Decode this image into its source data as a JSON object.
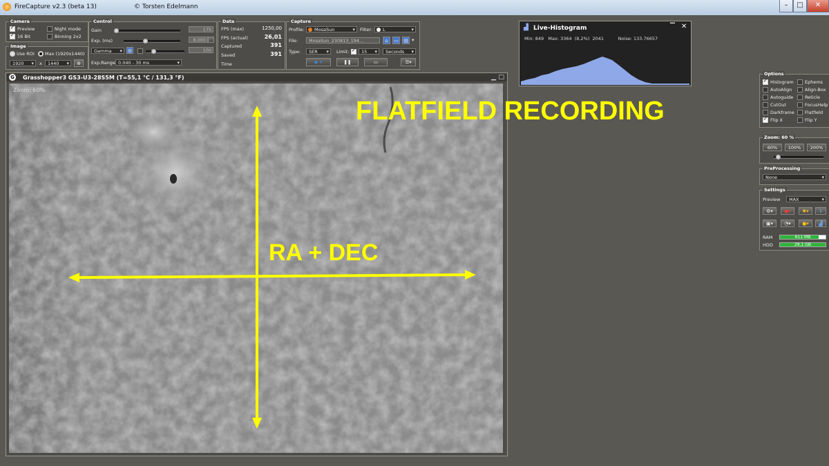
{
  "window": {
    "title": "FireCapture v2.3  (beta 13)",
    "credit": "© Torsten Edelmann"
  },
  "camera_panel": {
    "title": "Camera",
    "preview": "Preview",
    "bit16": "16 Bit",
    "night_mode": "Night mode",
    "binning": "Binning 2x2"
  },
  "image_panel": {
    "title": "Image",
    "use_roi": "Use ROI",
    "max": "Max (1920x1440)",
    "width": "1920",
    "x": "x",
    "height": "1440"
  },
  "control_panel": {
    "title": "Control",
    "gain_label": "Gain",
    "gain_value": "175",
    "exp_label": "Exp. (ms)",
    "exp_value": "8,000",
    "gamma_label": "Gamma",
    "gamma_value": "100",
    "exp_range_label": "Exp.Range:",
    "exp_range_value": "0.040 - 30 ms"
  },
  "data_panel": {
    "title": "Data",
    "fps_max_label": "FPS (max)",
    "fps_max": "1250,00",
    "fps_actual_label": "FPS (actual)",
    "fps_actual": "26,01",
    "captured_label": "Captured",
    "captured": "391",
    "saved_label": "Saved",
    "saved": "391",
    "time_label": "Time"
  },
  "capture_panel": {
    "title": "Capture",
    "profile_label": "Profile:",
    "profile": "MosaSun",
    "filter_label": "Filter:",
    "filter": "L",
    "file_label": "File:",
    "file": "MosaSun_230813_194...",
    "type_label": "Type:",
    "type": "SER",
    "limit_label": "Limit:",
    "limit": "15",
    "limit_unit": "Seconds"
  },
  "viewer": {
    "title": "Grasshopper3 GS3-U3-28S5M  (T=55,1 °C / 131,3 °F)",
    "zoom": "Zoom: 60%",
    "overlay_title": "FLATFIELD RECORDING",
    "overlay_axes": "RA + DEC",
    "accent": "#ffff00"
  },
  "histogram": {
    "title": "Live-Histogram",
    "stats": "Min: 849   Max: 3364  (8,2%)  2041          Noise: 133.76657",
    "bar_color": "#8fa8e8"
  },
  "options_panel": {
    "title": "Options",
    "items": [
      {
        "label": "Histogram",
        "checked": true
      },
      {
        "label": "Ephems",
        "checked": false
      },
      {
        "label": "AutoAlign",
        "checked": false
      },
      {
        "label": "Align-Box",
        "checked": false
      },
      {
        "label": "Autoguide",
        "checked": false
      },
      {
        "label": "Reticle",
        "checked": false
      },
      {
        "label": "CutOut",
        "checked": false
      },
      {
        "label": "FocusHelp",
        "checked": false
      },
      {
        "label": "Darkframe",
        "checked": false
      },
      {
        "label": "Flatfield",
        "checked": false
      },
      {
        "label": "Flip X",
        "checked": true
      },
      {
        "label": "Flip Y",
        "checked": false
      }
    ]
  },
  "zoom_panel": {
    "title": "Zoom: 60 %",
    "buttons": [
      "60%",
      "100%",
      "200%"
    ],
    "level": 0.05
  },
  "preprocessing_panel": {
    "title": "PreProcessing",
    "value": "None"
  },
  "settings_panel": {
    "title": "Settings",
    "preview_label": "Preview",
    "preview_value": "MAX",
    "ram_label": "RAM",
    "ram_value": "611 MB",
    "ram_fill": 0.85,
    "hdd_label": "HDD",
    "hdd_value": "29,1 GB",
    "hdd_fill": 1.0
  }
}
